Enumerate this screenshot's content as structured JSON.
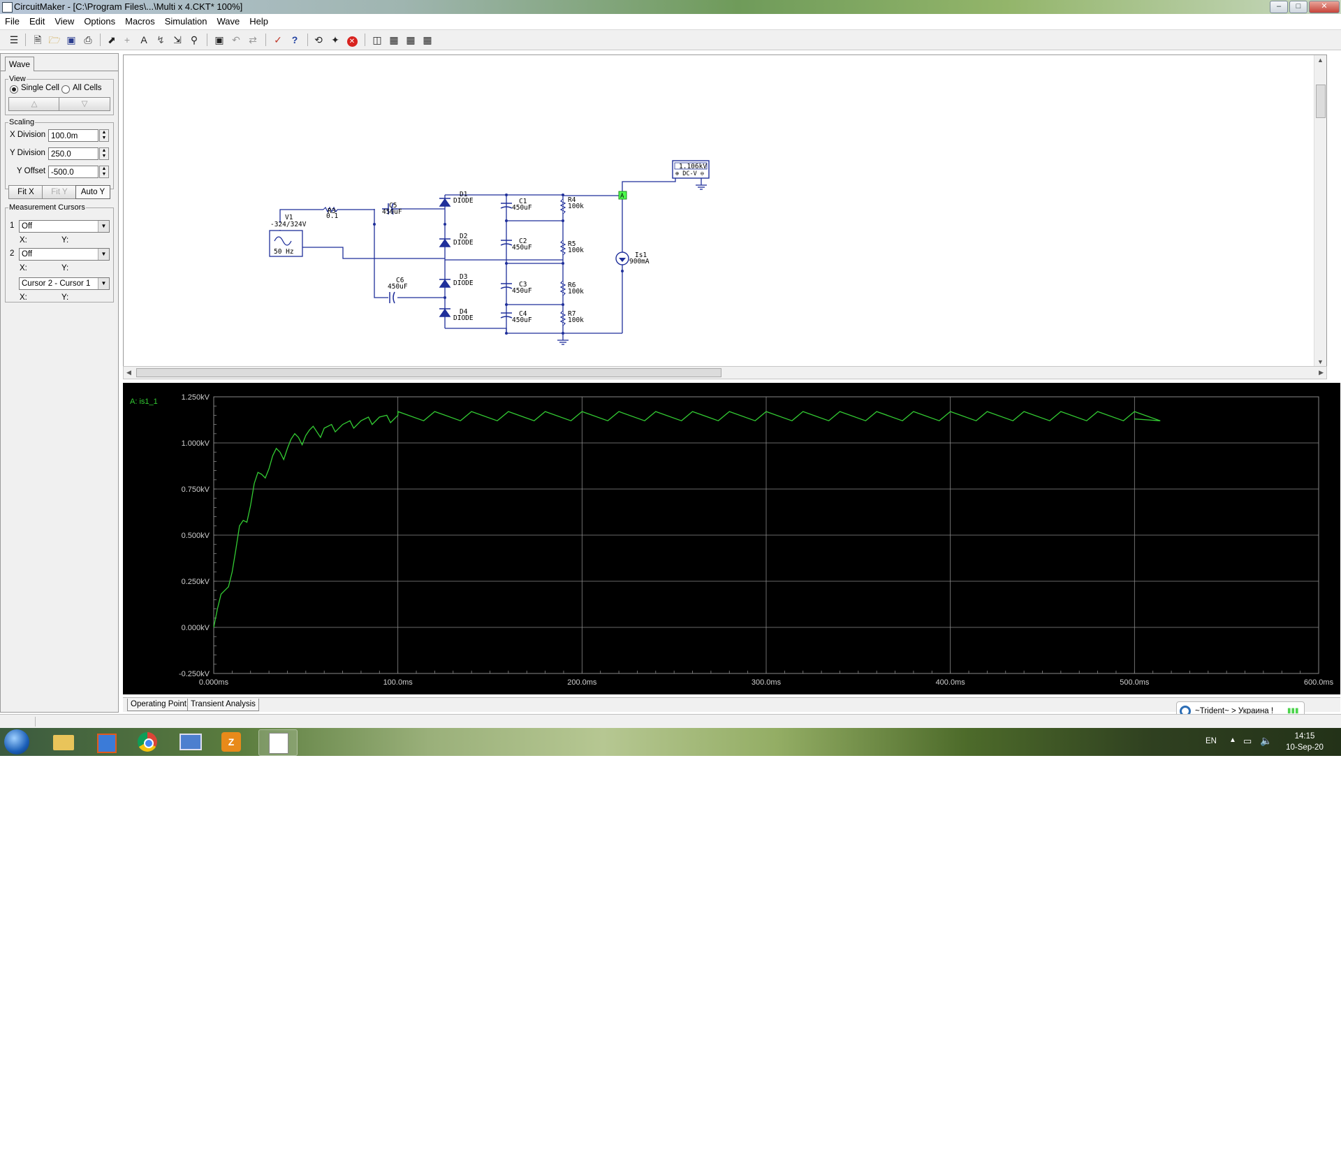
{
  "window": {
    "title": "CircuitMaker - [C:\\Program Files\\...\\Multi x 4.CKT* 100%]"
  },
  "menu": [
    "File",
    "Edit",
    "View",
    "Options",
    "Macros",
    "Simulation",
    "Wave",
    "Help"
  ],
  "toolbar_icons": [
    "library-icon",
    "new-icon",
    "open-icon",
    "save-icon",
    "print-icon",
    "arrow-icon",
    "wire-icon",
    "text-icon",
    "probe-icon",
    "zoom-pointer-icon",
    "zoom-icon",
    "zoom-fit-icon",
    "undo-icon",
    "redo-icon",
    "check-icon",
    "help-icon",
    "reset-icon",
    "run-icon",
    "stop-icon",
    "trace-icon",
    "wave-icon",
    "wave2-icon",
    "wave3-icon"
  ],
  "panel": {
    "tab": "Wave",
    "view": {
      "legend": "View",
      "single": "Single Cell",
      "all": "All Cells",
      "up": "△",
      "down": "▽"
    },
    "scaling": {
      "legend": "Scaling",
      "xdiv_label": "X Division",
      "xdiv": "100.0m",
      "ydiv_label": "Y Division",
      "ydiv": "250.0",
      "yoff_label": "Y Offset",
      "yoff": "-500.0",
      "fitx": "Fit X",
      "fity": "Fit Y",
      "autoy": "Auto Y"
    },
    "cursors": {
      "legend": "Measurement Cursors",
      "c1_num": "1",
      "c1": "Off",
      "c2_num": "2",
      "c2": "Off",
      "diff": "Cursor 2 - Cursor 1",
      "x": "X:",
      "y": "Y:"
    }
  },
  "schematic": {
    "meter_value": "1.106kV",
    "meter_mode": "DC-V",
    "v1_name": "V1",
    "v1_value": "-324/324V",
    "v1_freq": "50 Hz",
    "r3_name": "R3",
    "r3_value": "0.1",
    "c5_name": "C5",
    "c5_value": "450uF",
    "c6_name": "C6",
    "c6_value": "450uF",
    "d1": "D1",
    "d2": "D2",
    "d3": "D3",
    "d4": "D4",
    "diode": "DIODE",
    "c1": "C1",
    "c2": "C2",
    "c3": "C3",
    "c4": "C4",
    "cap_value": "450uF",
    "r4": "R4",
    "r5": "R5",
    "r6": "R6",
    "r7": "R7",
    "res_value": "100k",
    "is1_name": "Is1",
    "is1_value": "900mA",
    "probe": "A"
  },
  "wave": {
    "trace_label": "A: is1_1",
    "trace_color": "#33cc33"
  },
  "chart_data": {
    "type": "line",
    "title": "",
    "xlabel": "",
    "ylabel": "",
    "x_ticks": [
      "0.000ms",
      "100.0ms",
      "200.0ms",
      "300.0ms",
      "400.0ms",
      "500.0ms",
      "600.0ms"
    ],
    "y_ticks": [
      "1.250kV",
      "1.000kV",
      "0.750kV",
      "0.500kV",
      "0.250kV",
      "0.000kV",
      "-0.250kV"
    ],
    "xlim": [
      0,
      600
    ],
    "ylim": [
      -0.25,
      1.25
    ],
    "series": [
      {
        "name": "A: is1_1",
        "x": [
          0,
          2,
          4,
          6,
          8,
          10,
          12,
          14,
          16,
          18,
          20,
          22,
          24,
          26,
          28,
          30,
          32,
          34,
          36,
          38,
          40,
          42,
          44,
          46,
          48,
          50,
          52,
          54,
          56,
          58,
          60,
          64,
          66,
          70,
          74,
          76,
          80,
          84,
          86,
          90,
          94,
          96,
          100,
          104,
          106,
          110,
          114,
          116,
          120,
          140,
          160,
          180,
          200,
          220,
          240,
          260,
          280,
          300,
          320,
          340,
          360,
          380,
          400,
          420,
          440,
          460,
          480,
          500
        ],
        "y": [
          0.0,
          0.1,
          0.18,
          0.2,
          0.22,
          0.3,
          0.42,
          0.55,
          0.58,
          0.57,
          0.66,
          0.78,
          0.84,
          0.83,
          0.81,
          0.86,
          0.93,
          0.97,
          0.95,
          0.91,
          0.97,
          1.02,
          1.05,
          1.03,
          0.99,
          1.04,
          1.07,
          1.09,
          1.06,
          1.03,
          1.08,
          1.1,
          1.06,
          1.1,
          1.12,
          1.08,
          1.12,
          1.14,
          1.1,
          1.14,
          1.15,
          1.11,
          1.15,
          1.16,
          1.12,
          1.16,
          1.17,
          1.12,
          1.17,
          1.17,
          1.17,
          1.17,
          1.17,
          1.17,
          1.17,
          1.17,
          1.17,
          1.17,
          1.17,
          1.17,
          1.17,
          1.17,
          1.17,
          1.17,
          1.17,
          1.17,
          1.17,
          1.16
        ]
      }
    ],
    "ripple": {
      "period_ms": 20,
      "low": 1.12,
      "high": 1.17,
      "start_ms": 100,
      "end_ms": 500
    },
    "grid": true
  },
  "bottom_tabs": [
    "Operating Point",
    "Transient Analysis"
  ],
  "notification": "~Trident~ > Украина !",
  "taskbar": {
    "lang": "EN",
    "time": "14:15",
    "date": "10-Sep-20"
  }
}
